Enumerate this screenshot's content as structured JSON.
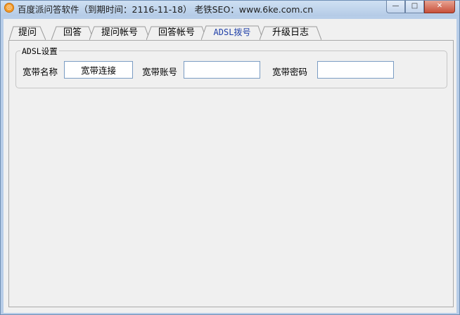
{
  "window": {
    "app_icon_glyph": "◎",
    "title": "百度派问答软件（到期时间：2116-11-18） 老铁SEO：www.6ke.com.cn",
    "controls": {
      "minimize": "—",
      "maximize": "□",
      "close": "✕"
    }
  },
  "tabs": [
    {
      "label": "提问"
    },
    {
      "label": "回答"
    },
    {
      "label": "提问帐号"
    },
    {
      "label": "回答帐号"
    },
    {
      "label": "ADSL拨号",
      "active": true
    },
    {
      "label": "升级日志"
    }
  ],
  "adsl": {
    "group_title": "ADSL设置",
    "name_label": "宽带名称",
    "name_value": "宽带连接",
    "account_label": "宽带账号",
    "account_value": "",
    "password_label": "宽带密码",
    "password_value": ""
  },
  "colors": {
    "active_tab_text": "#1f3fa8",
    "close_button": "#c7503a"
  }
}
